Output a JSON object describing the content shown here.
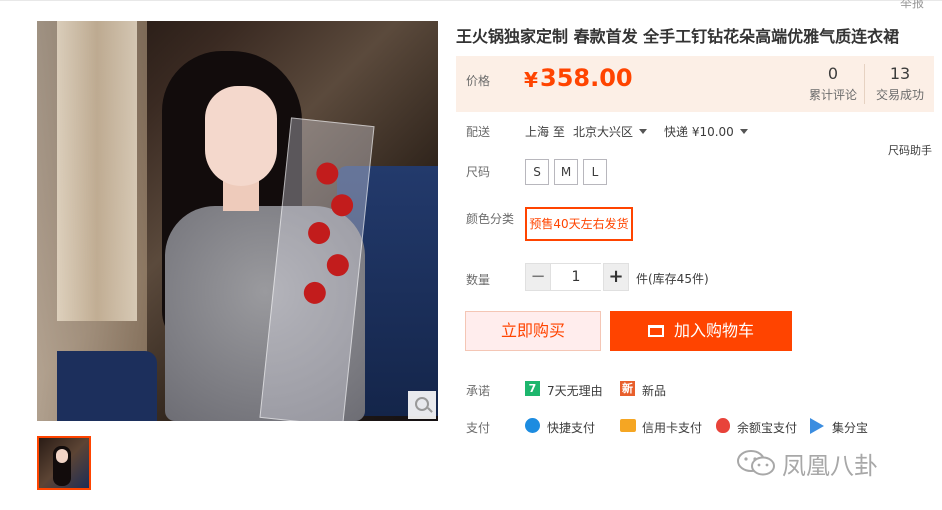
{
  "header": {
    "report_link": "举报"
  },
  "product": {
    "title": "王火锅独家定制 春款首发 全手工钉钻花朵高端优雅气质连衣裙",
    "price_label": "价格",
    "currency": "¥",
    "price": "358.00",
    "stats": [
      {
        "value": "0",
        "label": "累计评论"
      },
      {
        "value": "13",
        "label": "交易成功"
      }
    ]
  },
  "shipping": {
    "label": "配送",
    "from": "上海 至",
    "to": "北京大兴区",
    "method": "快递 ¥10.00",
    "size_helper": "尺码助手"
  },
  "size": {
    "label": "尺码",
    "options": [
      "S",
      "M",
      "L"
    ]
  },
  "color": {
    "label": "颜色分类",
    "option": "预售40天左右发货"
  },
  "quantity": {
    "label": "数量",
    "minus": "−",
    "value": "1",
    "plus": "+",
    "stock_text": "件(库存45件)"
  },
  "actions": {
    "buy_now": "立即购买",
    "add_to_cart": "加入购物车"
  },
  "promise": {
    "label": "承诺",
    "items": [
      {
        "icon": "seven-day-return-icon",
        "badge": "7",
        "text": "7天无理由",
        "color": "#1db66d"
      },
      {
        "icon": "new-product-icon",
        "badge": "新",
        "text": "新品",
        "color": "#e85f2c"
      }
    ]
  },
  "payment": {
    "label": "支付",
    "items": [
      {
        "icon": "quick-pay-icon",
        "text": "快捷支付",
        "color": "#1d8ce0"
      },
      {
        "icon": "credit-card-icon",
        "text": "信用卡支付",
        "color": "#f5a623"
      },
      {
        "icon": "yuebao-icon",
        "text": "余额宝支付",
        "color": "#e8433a"
      },
      {
        "icon": "jifenbao-icon",
        "text": "集分宝",
        "color": "#3b8de0"
      }
    ]
  },
  "watermark": {
    "text": "凤凰八卦"
  },
  "colors": {
    "accent": "#ff4400",
    "price_bg": "#fcefe6",
    "buy_bg": "#ffeded"
  }
}
